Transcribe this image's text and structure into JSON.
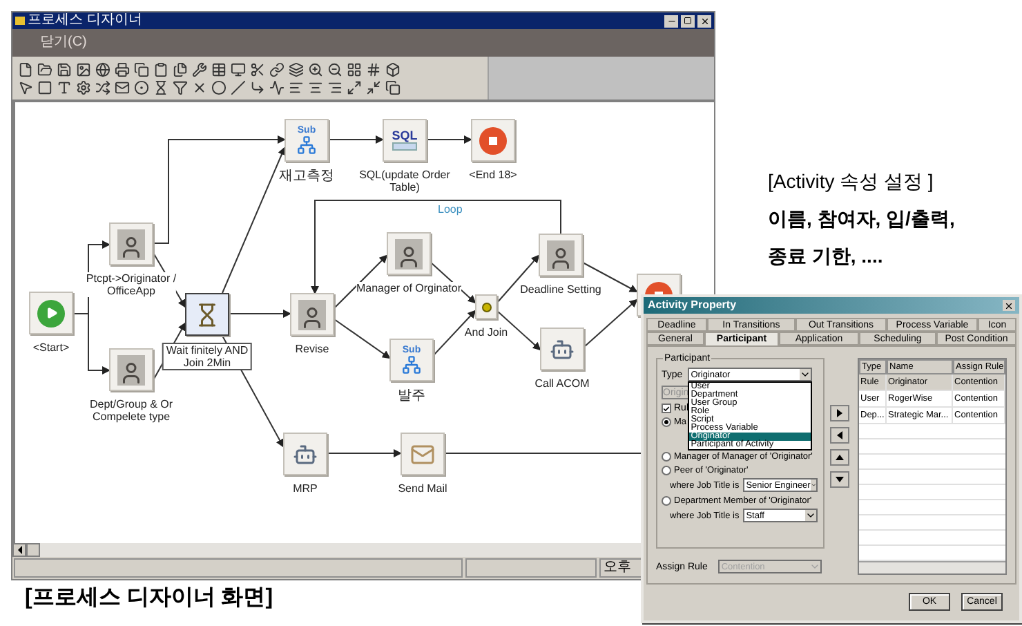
{
  "designer": {
    "title": "프로세스 디자이너",
    "menu": [
      {
        "label": "닫기(C)"
      }
    ],
    "canvas": {
      "nodes": [
        {
          "kind": "start",
          "label": [
            "<Start>"
          ],
          "selected": false
        },
        {
          "kind": "activity",
          "label": [
            "Ptcpt->Originator /",
            "OfficeApp"
          ],
          "selected": false
        },
        {
          "kind": "activity",
          "label": [
            "Dept/Group & Or",
            "Compelete type"
          ],
          "selected": false
        },
        {
          "kind": "timer",
          "label": [
            "Wait finitely AND",
            "Join  2Min"
          ],
          "selected": true
        },
        {
          "kind": "sub",
          "icon_text": "Sub",
          "label": [
            "재고측정"
          ],
          "selected": false
        },
        {
          "kind": "sql",
          "icon_text": "SQL",
          "label": [
            "SQL(update Order",
            "Table)"
          ],
          "selected": false
        },
        {
          "kind": "end",
          "label": [
            "<End 18>"
          ],
          "selected": false
        },
        {
          "kind": "activity",
          "label": [
            "Revise"
          ],
          "selected": false
        },
        {
          "kind": "activity",
          "label": [
            "Manager of Orginator"
          ],
          "selected": false
        },
        {
          "kind": "sub",
          "icon_text": "Sub",
          "label": [
            "발주"
          ],
          "selected": false
        },
        {
          "kind": "and_join",
          "label": [
            "And Join"
          ],
          "selected": false
        },
        {
          "kind": "activity",
          "label": [
            "Deadline Setting"
          ],
          "selected": false
        },
        {
          "kind": "app",
          "label": [
            "Call ACOM"
          ],
          "selected": false
        },
        {
          "kind": "end",
          "selected": false
        },
        {
          "kind": "app",
          "label": [
            "MRP"
          ],
          "selected": false
        },
        {
          "kind": "mail",
          "label": [
            "Send Mail"
          ],
          "selected": false
        }
      ],
      "loop_label": "Loop"
    },
    "status_bar": {
      "time": "오후"
    }
  },
  "caption": "[프로세스 디자이너 화면]",
  "annotation": {
    "lines": [
      "[Activity 속성 설정 ]",
      "이름, 참여자, 입/출력,",
      "종료 기한, ...."
    ]
  },
  "dialog": {
    "title": "Activity Property",
    "tab_rows": [
      [
        {
          "label": "Deadline",
          "selected": false
        },
        {
          "label": "In Transitions",
          "selected": false
        },
        {
          "label": "Out Transitions",
          "selected": false
        },
        {
          "label": "Process Variable",
          "selected": false
        },
        {
          "label": "Icon",
          "selected": false
        }
      ],
      [
        {
          "label": "General",
          "selected": false
        },
        {
          "label": "Participant",
          "selected": true
        },
        {
          "label": "Application",
          "selected": false
        },
        {
          "label": "Scheduling",
          "selected": false
        },
        {
          "label": "Post Condition",
          "selected": false
        }
      ]
    ],
    "participant": {
      "title": "Participant",
      "type_label": "Type",
      "type_value": "Originator",
      "type_options": [
        {
          "label": "User",
          "selected": false
        },
        {
          "label": "Department",
          "selected": false
        },
        {
          "label": "User Group",
          "selected": false
        },
        {
          "label": "Role",
          "selected": false
        },
        {
          "label": "Script",
          "selected": false
        },
        {
          "label": "Process Variable",
          "selected": false
        },
        {
          "label": "Originator",
          "selected": true
        },
        {
          "label": "Participant of Activity",
          "selected": false
        }
      ],
      "name_field": "Origin",
      "rule_checkbox": {
        "label": "Rul",
        "checked": true
      },
      "options": [
        {
          "label": "Ma",
          "selected": true
        },
        {
          "label": "Manager of Manager of 'Originator'",
          "selected": false
        },
        {
          "label": "Peer of 'Originator'",
          "selected": false,
          "job_title_label": "where Job Title is",
          "job_title": "Senior Engineer"
        },
        {
          "label": "Department Member of 'Originator'",
          "selected": false,
          "job_title_label": "where Job Title is",
          "job_title": "Staff"
        }
      ]
    },
    "assign_rule": {
      "label": "Assign Rule",
      "value": "Contention",
      "disabled": true
    },
    "table": {
      "columns": [
        "Type",
        "Name",
        "Assign Rule"
      ],
      "rows": [
        {
          "cells": [
            "Rule",
            "Originator",
            "Contention"
          ],
          "selected": true
        },
        {
          "cells": [
            "User",
            "RogerWise",
            "Contention"
          ],
          "selected": false
        },
        {
          "cells": [
            "Dep...",
            "Strategic Mar...",
            "Contention"
          ],
          "selected": false
        }
      ]
    },
    "buttons": [
      "OK",
      "Cancel"
    ]
  }
}
